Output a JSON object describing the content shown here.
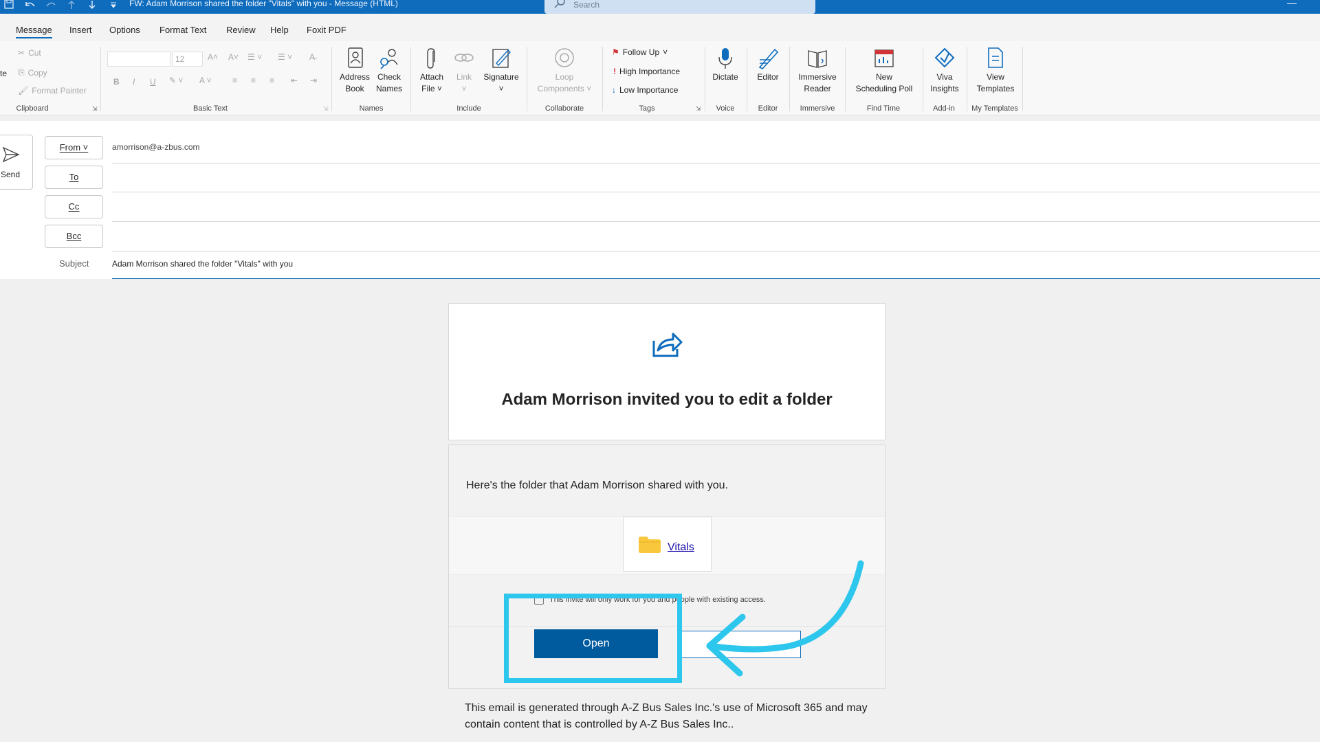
{
  "window": {
    "title": "FW: Adam Morrison shared the folder \"Vitals\" with you  -  Message (HTML)",
    "search_placeholder": "Search"
  },
  "menu_tabs": [
    "Message",
    "Insert",
    "Options",
    "Format Text",
    "Review",
    "Help",
    "Foxit PDF"
  ],
  "ribbon": {
    "clipboard": {
      "paste_partial": "te",
      "cut": "Cut",
      "copy": "Copy",
      "format_painter": "Format Painter",
      "label": "Clipboard"
    },
    "basic_text": {
      "font_size": "12",
      "label": "Basic Text",
      "bold": "B",
      "italic": "I",
      "underline": "U"
    },
    "names": {
      "address_book": [
        "Address",
        "Book"
      ],
      "check_names": [
        "Check",
        "Names"
      ],
      "label": "Names"
    },
    "include": {
      "attach_file": [
        "Attach",
        "File"
      ],
      "link": "Link",
      "signature": "Signature",
      "label": "Include"
    },
    "collaborate": {
      "loop": [
        "Loop",
        "Components"
      ],
      "label": "Collaborate"
    },
    "tags": {
      "follow_up": "Follow Up",
      "high_importance": "High Importance",
      "low_importance": "Low Importance",
      "label": "Tags"
    },
    "voice": {
      "dictate": "Dictate",
      "label": "Voice"
    },
    "editor": {
      "editor": "Editor",
      "label": "Editor"
    },
    "immersive": {
      "reader": [
        "Immersive",
        "Reader"
      ],
      "label": "Immersive"
    },
    "find_time": {
      "poll": [
        "New",
        "Scheduling Poll"
      ],
      "label": "Find Time"
    },
    "add_in": {
      "viva": [
        "Viva",
        "Insights"
      ],
      "label": "Add-in"
    },
    "templates": {
      "view": [
        "View",
        "Templates"
      ],
      "label": "My Templates"
    }
  },
  "compose": {
    "send_label": "Send",
    "from_label": "From",
    "from_value": "amorrison@a-zbus.com",
    "to_label": "To",
    "cc_label": "Cc",
    "bcc_label": "Bcc",
    "subject_label": "Subject",
    "subject_value": "Adam Morrison shared the folder \"Vitals\" with you"
  },
  "body": {
    "heading": "Adam Morrison invited you to edit a folder",
    "description": "Here's the folder that Adam Morrison shared with you.",
    "folder_name": "Vitals",
    "notice": "This invite will only work for you and people with existing access.",
    "open_button": "Open",
    "footer": "This email is generated through A-Z Bus Sales Inc.'s use of Microsoft 365 and may contain content that is controlled by A-Z Bus Sales Inc.."
  },
  "colors": {
    "title_bar": "#0f6cbd",
    "open_button": "#005a9e",
    "highlight": "#2dc6ec",
    "folder": "#f8c73c"
  }
}
